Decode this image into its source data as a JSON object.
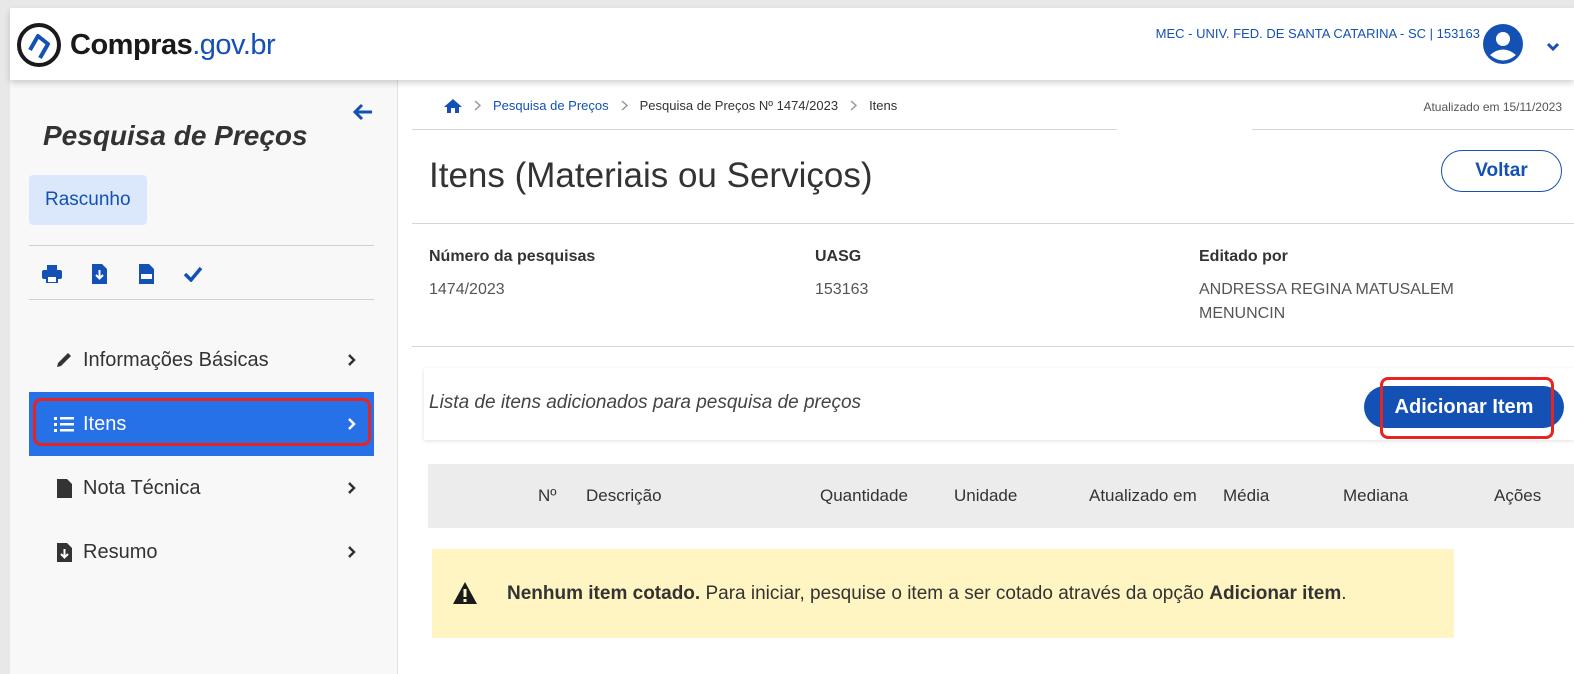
{
  "header": {
    "logo_brand": "Compras",
    "logo_domain": ".gov.br",
    "org": "MEC - UNIV. FED. DE SANTA CATARINA - SC | 153163",
    "user_icon": "user-circle-icon"
  },
  "sidebar": {
    "title": "Pesquisa de Preços",
    "status_badge": "Rascunho",
    "tools": [
      "print-icon",
      "file-download-icon",
      "csv-file-icon",
      "check-icon"
    ],
    "items": [
      {
        "label": "Informações Básicas",
        "icon": "pencil-icon"
      },
      {
        "label": "Itens",
        "icon": "list-icon",
        "active": true
      },
      {
        "label": "Nota Técnica",
        "icon": "file-icon"
      },
      {
        "label": "Resumo",
        "icon": "file-download-icon"
      }
    ]
  },
  "breadcrumb": {
    "home_icon": "home-icon",
    "items": [
      "Pesquisa de Preços",
      "Pesquisa de Preços Nº 1474/2023",
      "Itens"
    ]
  },
  "updated": "Atualizado em 15/11/2023",
  "page": {
    "title": "Itens (Materiais ou Serviços)",
    "back_label": "Voltar"
  },
  "meta": {
    "numero_label": "Número da pesquisas",
    "numero_value": "1474/2023",
    "uasg_label": "UASG",
    "uasg_value": "153163",
    "editor_label": "Editado por",
    "editor_line1": "ANDRESSA REGINA MATUSALEM",
    "editor_line2": "MENUNCIN"
  },
  "list": {
    "description": "Lista de itens adicionados para pesquisa de preços",
    "add_label": "Adicionar Item"
  },
  "table": {
    "columns": [
      "Nº",
      "Descrição",
      "Quantidade",
      "Unidade",
      "Atualizado em",
      "Média",
      "Mediana",
      "Ações"
    ]
  },
  "alert": {
    "strong1": "Nenhum item cotado.",
    "text": " Para iniciar, pesquise o item a ser cotado através da opção ",
    "strong2": "Adicionar item",
    "end": "."
  },
  "colors": {
    "primary": "#1351b4",
    "active_nav": "#2670e8",
    "highlight": "#e52521",
    "alert_bg": "#fff5c2"
  }
}
